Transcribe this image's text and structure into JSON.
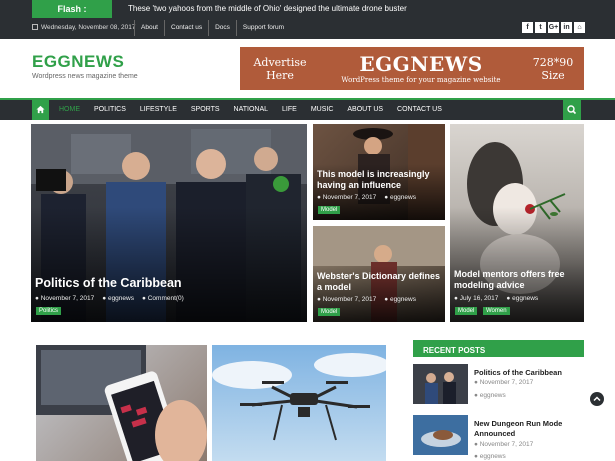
{
  "topbar": {
    "flash_label": "Flash :",
    "flash_text": "These 'two yahoos from the middle of Ohio' designed the ultimate drone buster",
    "date": "Wednesday, November 08, 2017",
    "links": [
      "About",
      "Contact us",
      "Docs",
      "Support forum"
    ],
    "social": [
      "f",
      "t",
      "G+",
      "in",
      "⌂"
    ]
  },
  "header": {
    "logo": "EGGNEWS",
    "tagline": "Wordpress news magazine theme",
    "ad": {
      "left_line1": "Advertise",
      "left_line2": "Here",
      "brand": "EGGNEWS",
      "sub": "WordPress theme for your magazine website",
      "size_line1": "728*90",
      "size_line2": "Size"
    }
  },
  "nav": {
    "items": [
      "HOME",
      "POLITICS",
      "LIFESTYLE",
      "SPORTS",
      "NATIONAL",
      "LIFE",
      "MUSIC",
      "ABOUT US",
      "CONTACT US"
    ],
    "active": "HOME"
  },
  "featured": [
    {
      "title": "Politics of the Caribbean",
      "date": "November 7, 2017",
      "author": "eggnews",
      "comments": "Comment(0)",
      "tags": [
        "Politics"
      ]
    },
    {
      "title": "This model is increasingly having an influence",
      "date": "November 7, 2017",
      "author": "eggnews",
      "tags": [
        "Model"
      ]
    },
    {
      "title": "Model mentors offers free modeling advice",
      "date": "July 16, 2017",
      "author": "eggnews",
      "tags": [
        "Model",
        "Women"
      ]
    },
    {
      "title": "Webster's Dictionary defines a model",
      "date": "November 7, 2017",
      "author": "eggnews",
      "tags": [
        "Model"
      ]
    }
  ],
  "recent": {
    "heading": "RECENT POSTS",
    "items": [
      {
        "title": "Politics of the Caribbean",
        "date": "November 7, 2017",
        "author": "eggnews"
      },
      {
        "title": "New Dungeon Run Mode Announced",
        "date": "November 7, 2017",
        "author": "eggnews"
      }
    ]
  },
  "colors": {
    "accent": "#30a049",
    "dark": "#2b2f33",
    "ad": "#b05b3a"
  }
}
